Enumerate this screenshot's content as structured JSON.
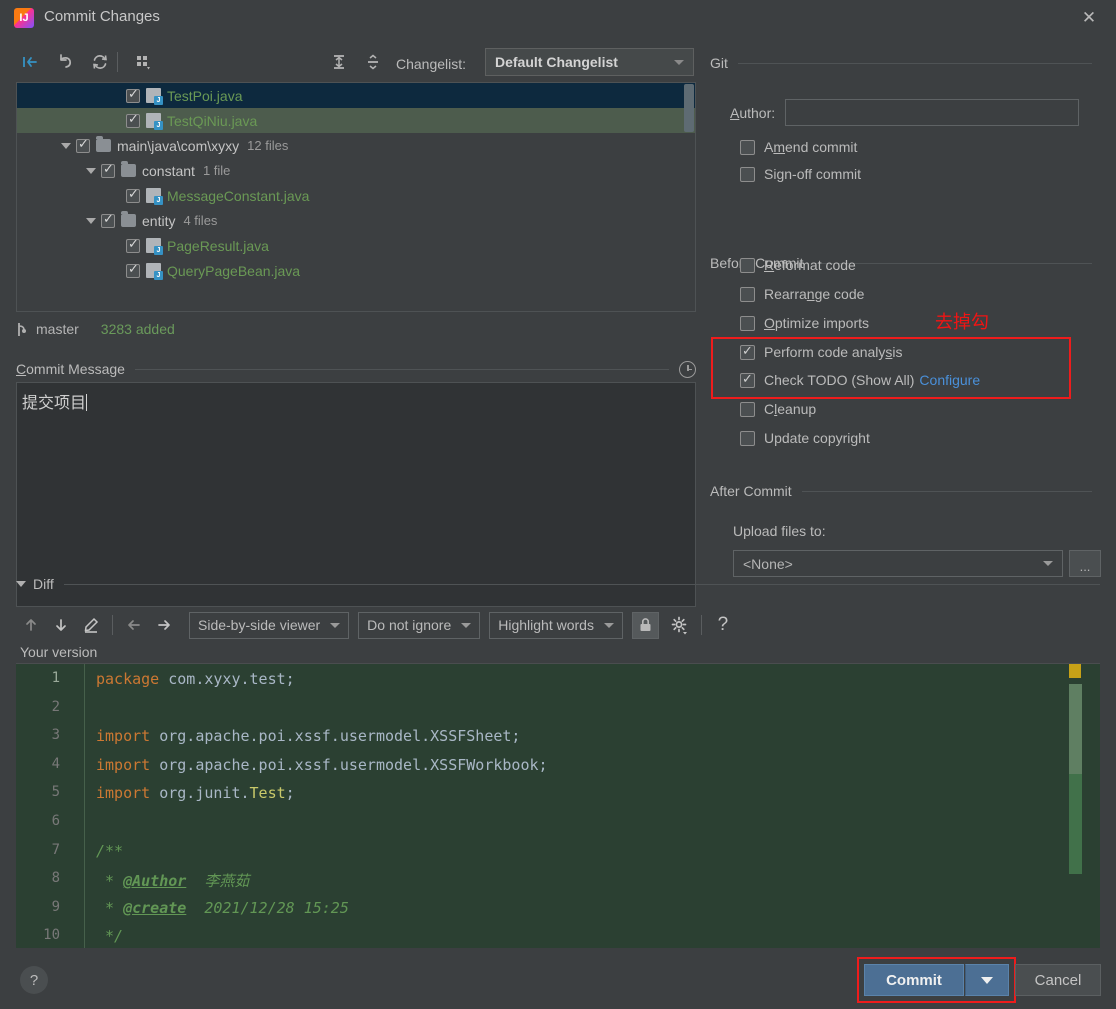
{
  "window": {
    "title": "Commit Changes",
    "app_icon": "intellij-idea-icon",
    "close_icon": "close-icon"
  },
  "changelist_toolbar": {
    "icons": [
      {
        "name": "move-to-another-changelist-icon",
        "glyph": "move"
      },
      {
        "name": "rollback-icon",
        "glyph": "undo"
      },
      {
        "name": "refresh-icon",
        "glyph": "refresh"
      },
      {
        "name": "group-by-icon",
        "glyph": "group"
      },
      {
        "name": "expand-all-icon",
        "glyph": "expand"
      },
      {
        "name": "collapse-all-icon",
        "glyph": "collapse"
      }
    ],
    "changelist_label": "Changelist:",
    "changelist_value": "Default Changelist"
  },
  "file_tree": [
    {
      "indent": 3,
      "checked": true,
      "type": "file",
      "name": "TestPoi.java",
      "count": "",
      "state": "selected"
    },
    {
      "indent": 3,
      "checked": true,
      "type": "file",
      "name": "TestQiNiu.java",
      "count": "",
      "state": "selected2"
    },
    {
      "indent": 1,
      "checked": true,
      "type": "folder",
      "name": "main\\java\\com\\xyxy",
      "count": "12 files",
      "expanded": true
    },
    {
      "indent": 2,
      "checked": true,
      "type": "folder",
      "name": "constant",
      "count": "1 file",
      "expanded": true
    },
    {
      "indent": 3,
      "checked": true,
      "type": "file",
      "name": "MessageConstant.java",
      "count": ""
    },
    {
      "indent": 2,
      "checked": true,
      "type": "folder",
      "name": "entity",
      "count": "4 files",
      "expanded": true
    },
    {
      "indent": 3,
      "checked": true,
      "type": "file",
      "name": "PageResult.java",
      "count": ""
    },
    {
      "indent": 3,
      "checked": true,
      "type": "file",
      "name": "QueryPageBean.java",
      "count": ""
    }
  ],
  "branch_bar": {
    "icon": "git-branch-icon",
    "branch": "master",
    "stats": "3283 added"
  },
  "commit_message": {
    "label": "Commit Message",
    "history_icon": "clock-icon",
    "value": "提交项目"
  },
  "git_section": {
    "title": "Git",
    "author_label": "Author:",
    "author_value": "",
    "checkboxes": [
      {
        "name": "amend-commit",
        "label": "Amend commit",
        "checked": false
      },
      {
        "name": "sign-off-commit",
        "label": "Sign-off commit",
        "checked": false
      }
    ]
  },
  "before_commit": {
    "title": "Before Commit",
    "checkboxes": [
      {
        "name": "reformat-code",
        "label": "Reformat code",
        "checked": false
      },
      {
        "name": "rearrange-code",
        "label": "Rearrange code",
        "checked": false
      },
      {
        "name": "optimize-imports",
        "label": "Optimize imports",
        "checked": false
      },
      {
        "name": "perform-code-analysis",
        "label": "Perform code analysis",
        "checked": true
      },
      {
        "name": "check-todo",
        "label": "Check TODO (Show All)",
        "checked": true,
        "link": "Configure"
      },
      {
        "name": "cleanup",
        "label": "Cleanup",
        "checked": false
      },
      {
        "name": "update-copyright",
        "label": "Update copyright",
        "checked": false
      }
    ]
  },
  "after_commit": {
    "title": "After Commit",
    "upload_label": "Upload files to:",
    "upload_value": "<None>",
    "browse_label": "..."
  },
  "annotations": {
    "uncheck_note": "去掉勾",
    "color": "#ee1c1c"
  },
  "diff": {
    "title": "Diff",
    "toolbar_icons": [
      {
        "name": "previous-difference-icon",
        "glyph": "arrow-up"
      },
      {
        "name": "next-difference-icon",
        "glyph": "arrow-down"
      },
      {
        "name": "annotate-icon",
        "glyph": "pencil"
      },
      {
        "name": "accept-left-icon",
        "glyph": "arrow-left"
      },
      {
        "name": "accept-right-icon",
        "glyph": "arrow-right"
      }
    ],
    "viewer_mode": "Side-by-side viewer",
    "whitespace_mode": "Do not ignore",
    "highlight_mode": "Highlight words",
    "lock_icon": "lock-icon",
    "settings_icon": "gear-icon",
    "help_icon": "question-mark-icon",
    "pane_label": "Your version"
  },
  "code": {
    "lines": [
      {
        "n": "1",
        "tokens": [
          {
            "t": "package",
            "c": "kw"
          },
          {
            "t": " com.xyxy.test;",
            "c": "pl"
          }
        ]
      },
      {
        "n": "2",
        "tokens": []
      },
      {
        "n": "3",
        "tokens": [
          {
            "t": "import",
            "c": "kw"
          },
          {
            "t": " org.apache.poi.xssf.usermodel.XSSFSheet;",
            "c": "pl"
          }
        ]
      },
      {
        "n": "4",
        "tokens": [
          {
            "t": "import",
            "c": "kw"
          },
          {
            "t": " org.apache.poi.xssf.usermodel.XSSFWorkbook;",
            "c": "pl"
          }
        ]
      },
      {
        "n": "5",
        "tokens": [
          {
            "t": "import",
            "c": "kw"
          },
          {
            "t": " org.junit.",
            "c": "pl"
          },
          {
            "t": "Test",
            "c": "cls"
          },
          {
            "t": ";",
            "c": "pl"
          }
        ]
      },
      {
        "n": "6",
        "tokens": []
      },
      {
        "n": "7",
        "tokens": [
          {
            "t": "/**",
            "c": "cmt"
          }
        ]
      },
      {
        "n": "8",
        "tokens": [
          {
            "t": " * ",
            "c": "cmt"
          },
          {
            "t": "@Author",
            "c": "tag"
          },
          {
            "t": "  李燕茹",
            "c": "cmt"
          }
        ]
      },
      {
        "n": "9",
        "tokens": [
          {
            "t": " * ",
            "c": "cmt"
          },
          {
            "t": "@create",
            "c": "tag"
          },
          {
            "t": "  2021/12/28 15:25",
            "c": "cmt"
          }
        ]
      },
      {
        "n": "10",
        "tokens": [
          {
            "t": " */",
            "c": "cmt"
          }
        ]
      }
    ]
  },
  "footer": {
    "help_label": "?",
    "commit_label": "Commit",
    "cancel_label": "Cancel"
  }
}
